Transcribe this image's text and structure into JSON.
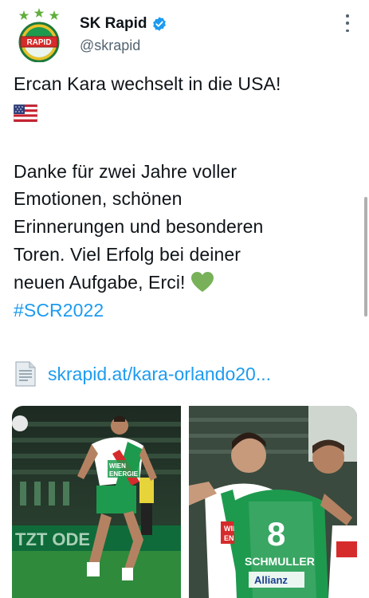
{
  "account": {
    "display_name": "SK Rapid",
    "handle": "@skrapid",
    "avatar_text": "RAPID",
    "verified": true
  },
  "tweet": {
    "line1": "Ercan Kara wechselt in die USA!",
    "flag": "us-flag-icon",
    "body_lines": [
      "Danke für zwei Jahre voller",
      "Emotionen, schönen",
      "Erinnerungen und besonderen",
      "Toren. Viel Erfolg bei deiner",
      "neuen Aufgabe, Erci!"
    ],
    "heart": "green-heart-icon",
    "hashtag": "#SCR2022"
  },
  "link": {
    "icon": "document-icon",
    "text": "skrapid.at/kara-orlando20..."
  },
  "media": [
    {
      "name": "photo-player-running",
      "shirt_text": [
        "WIEN",
        "ENERGIE"
      ],
      "banner_text": "TZT ODE"
    },
    {
      "name": "photo-team-celebrating",
      "shirt_number": "8",
      "shirt_text": [
        "WIEN",
        "ENERGIE"
      ],
      "name_text": "SCHMULLER",
      "sponsor_text": "Allianz"
    }
  ],
  "colors": {
    "accent": "#1d9bf0",
    "text": "#0f1419",
    "secondary": "#536471",
    "rapid_green": "#1e9a4e",
    "heart_green": "#78b159"
  }
}
